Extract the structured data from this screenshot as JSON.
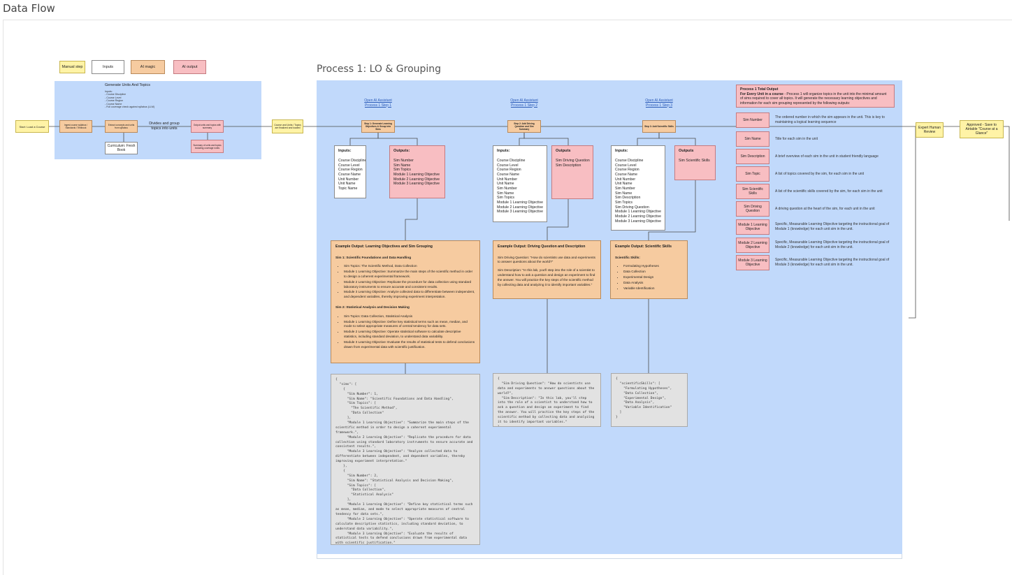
{
  "page_title": "Data Flow",
  "legend": {
    "manual": "Manual step",
    "inputs": "Inputs",
    "ai_magic": "AI magic",
    "ai_output": "AI output"
  },
  "left_panel": {
    "title": "Generate Units And Topics",
    "notes": [
      "Inputs:",
      "- Course Discipline",
      "- Course Level",
      "- Course Region",
      "- Course Name",
      "- Full coverage check against syllabus (LLM)"
    ],
    "start": "Start: Load a Course",
    "step1": "Ingest course syllabus / Standards / Textbook",
    "step2": "Extract concepts and units from syllabus",
    "step3": "Divides and group topics into units",
    "step4": "Output units and topics with summary",
    "curriculum": "Curriculum: Fresh Book",
    "summary": "Summary of units and topics including coverage notes",
    "handoff": "Course and Units / Topics are finalized and loaded"
  },
  "process_title": "Process 1: LO & Grouping",
  "steps": [
    {
      "link": [
        "Open AI Assistant",
        "Process 1 Step 1"
      ],
      "node": "Step 1: Generate Learning Objectives & Group into Sims",
      "inputs_label": "Inputs:",
      "inputs": [
        "Course Discipline",
        "Course Level",
        "Course Region",
        "Course Name",
        "Unit Number",
        "Unit Name",
        "Topic Name"
      ],
      "outputs_label": "Outputs:",
      "outputs": [
        "Sim Number",
        "Sim Name",
        "Sim Topics",
        "Module 1 Learning Objective",
        "Module 2 Learning Objective",
        "Module 3 Learning Objective"
      ]
    },
    {
      "link": [
        "Open AI Assistant",
        "Process 1 Step 2"
      ],
      "node": "Step 2: Add Driving Question and Sim Summary",
      "inputs_label": "Inputs:",
      "inputs": [
        "Course Discipline",
        "Course Level",
        "Course Region",
        "Course Name",
        "Unit Number",
        "Unit Name",
        "Sim Number",
        "Sim Name",
        "Sim Topics",
        "Module 1 Learning Objective",
        "Module 2 Learning Objective",
        "Module 3 Learning Objective"
      ],
      "outputs_label": "Outputs",
      "outputs": [
        "Sim Driving Question",
        "Sim Description"
      ]
    },
    {
      "link": [
        "Open AI Assistant",
        "Process 1 Step 3"
      ],
      "node": "Step 3: Add Scientific Skills",
      "inputs_label": "Inputs:",
      "inputs": [
        "Course Discipline",
        "Course Level",
        "Course Region",
        "Course Name",
        "Unit Number",
        "Unit Name",
        "Sim Number",
        "Sim Name",
        "Sim Description",
        "Sim Topics",
        "Sim Driving Question",
        "Module 1 Learning Objective",
        "Module 2 Learning Objective",
        "Module 3 Learning Objective"
      ],
      "outputs_label": "Outputs",
      "outputs": [
        "Sim Scientific Skills"
      ]
    }
  ],
  "example1": {
    "heading": "Example Output: Learning Objectives and Sim Grouping",
    "sim1_title": "Sim 1: Scientific Foundations and Data Handling",
    "sim1_items": [
      "Sim Topics: The Scientific Method, Data Collection",
      "Module 1 Learning Objective: Summarize the main steps of the scientific method in order to design a coherent experimental framework.",
      "Module 2 Learning Objective: Replicate the procedure for data collection using standard laboratory instruments to ensure accurate and consistent results.",
      "Module 3 Learning Objective: Analyze collected data to differentiate between independent, and dependent variables, thereby improving experiment interpretation."
    ],
    "sim2_title": "Sim 2: Statistical Analysis and Decision Making",
    "sim2_items": [
      "Sim Topics: Data Collection, Statistical Analysis",
      "Module 1 Learning Objective: Define key statistical terms such as mean, median, and mode to select appropriate measures of central tendency for data sets.",
      "Module 2 Learning Objective: Operate statistical software to calculate descriptive statistics, including standard deviation, to understand data variability.",
      "Module 3 Learning Objective: Evaluate the results of statistical tests to defend conclusions drawn from experimental data with scientific justification."
    ]
  },
  "example2": {
    "heading": "Example Output: Driving Question and Description",
    "dq": "Sim Driving Question: \"How do scientists use data and experiments to answer questions about the world?\"",
    "desc": "Sim Description: \"In this lab, you'll step into the role of a scientist to understand how to ask a question and design an experiment to find the answer. You will practice the key steps of the scientific method by collecting data and analyzing it to identify important variables.\""
  },
  "example3": {
    "heading": "Example Output: Scientific Skills",
    "sub": "Scientific Skills:",
    "items": [
      "Formulating Hypotheses",
      "Data Collection",
      "Experimental Design",
      "Data Analysis",
      "Variable Identification"
    ]
  },
  "json1": "{\n  \"sims\": [\n    {\n      \"Sim Number\": 1,\n      \"Sim Name\": \"Scientific Foundations and Data Handling\",\n      \"Sim Topics\": [\n        \"The Scientific Method\",\n        \"Data Collection\"\n      ],\n      \"Module 1 Learning Objective\": \"Summarize the main steps of the scientific method in order to design a coherent experimental framework.\",\n      \"Module 2 Learning Objective\": \"Replicate the procedure for data collection using standard laboratory instruments to ensure accurate and consistent results.\",\n      \"Module 3 Learning Objective\": \"Analyze collected data to differentiate between independent, and dependent variables, thereby improving experiment interpretation.\"\n    },\n    {\n      \"Sim Number\": 2,\n      \"Sim Name\": \"Statistical Analysis and Decision Making\",\n      \"Sim Topics\": [\n        \"Data Collection\",\n        \"Statistical Analysis\"\n      ],\n      \"Module 1 Learning Objective\": \"Define key statistical terms such as mean, median, and mode to select appropriate measures of central tendency for data sets.\",\n      \"Module 2 Learning Objective\": \"Operate statistical software to calculate descriptive statistics, including standard deviation, to understand data variability.\",\n      \"Module 3 Learning Objective\": \"Evaluate the results of statistical tests to defend conclusions drawn from experimental data with scientific justification.\"\n    }\n  ]\n}",
  "json2": "{\n  \"Sim Driving Question\": \"How do scientists use data and experiments to answer questions about the world?\",\n  \"Sim Description\": \"In this lab, you'll step into the role of a scientist to understand how to ask a question and design an experiment to find the answer. You will practice the key steps of the scientific method by collecting data and analyzing it to identify important variables.\"\n}",
  "json3": "{\n  \"scientificSkills\": [\n    \"Formulating Hypotheses\",\n    \"Data Collection\",\n    \"Experimental Design\",\n    \"Data Analysis\",\n    \"Variable Identification\"\n  ]\n}",
  "total_output": {
    "title": "Process 1 Total Output",
    "subtitle": "For Every Unit in a course",
    "text": "- Process 1 will organize topics in the unit into the minimal amount of sims required to cover all topics. It will generate the necessary learning objectives and information for each sim grouping represented by the following outputs:"
  },
  "definitions": [
    {
      "key": "Sim Number",
      "val": "The ordered number in which the sim appears in the unit. This is key to maintaining a logical learning sequence"
    },
    {
      "key": "Sim Name",
      "val": "Title for each sim in the unit"
    },
    {
      "key": "Sim Description",
      "val": "A brief overview of each sim in the unit in student friendly language"
    },
    {
      "key": "Sim Topic",
      "val": "A list of topics covered by the sim, for each sim in the unit"
    },
    {
      "key": "Sim Scientific Skills",
      "val": "A list of the scientific skills covered by the sim, for each sim in the unit"
    },
    {
      "key": "Sim Driving Question",
      "val": "A driving question at the heart of the sim, for each unit in the unit"
    },
    {
      "key": "Module 1 Learning Objective",
      "val": "Specific, Measurable Learning Objective targeting the instructional goal of Module 1 (knowledge) for each unit sim in the unit."
    },
    {
      "key": "Module 2 Learning Objective",
      "val": "Specific, Measurable Learning Objective targeting the instructional goal of Module 2 (knowledge) for each unit sim in the unit."
    },
    {
      "key": "Module 3 Learning Objective",
      "val": "Specific, Measurable Learning Objective targeting the instructional goal of Module 3 (knowledge) for each unit sim in the unit."
    }
  ],
  "expert_review": "Expert Human Review",
  "approved": "Approved - Save to Airtable \"Course at a Glance\"",
  "colors": {
    "panel_blue": "#c1d9fb",
    "manual_yellow": "#fff3a6",
    "ai_magic_orange": "#f6cba0",
    "ai_output_pink": "#f8bec2"
  }
}
